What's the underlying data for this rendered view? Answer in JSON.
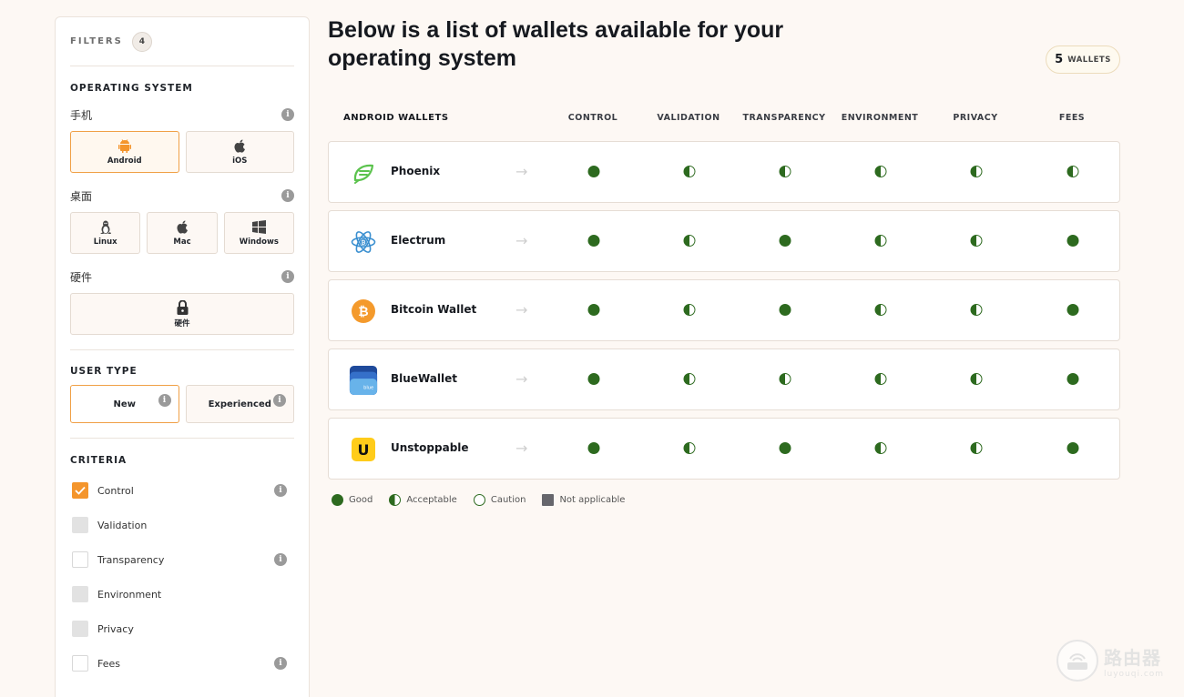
{
  "sidebar": {
    "filters_label": "FILTERS",
    "filters_count": "4",
    "os_section": "OPERATING SYSTEM",
    "mobile_label": "手机",
    "mobile_options": [
      "Android",
      "iOS"
    ],
    "desktop_label": "桌面",
    "desktop_options": [
      "Linux",
      "Mac",
      "Windows"
    ],
    "hardware_label": "硬件",
    "hardware_option": "硬件",
    "user_type_section": "USER TYPE",
    "user_types": [
      "New",
      "Experienced"
    ],
    "criteria_section": "CRITERIA",
    "criteria": [
      "Control",
      "Validation",
      "Transparency",
      "Environment",
      "Privacy",
      "Fees"
    ]
  },
  "main": {
    "title": "Below is a list of wallets available for your operating system",
    "wallet_count": "5",
    "wallet_count_label": "WALLETS",
    "table_heading": "ANDROID WALLETS",
    "columns": [
      "CONTROL",
      "VALIDATION",
      "TRANSPARENCY",
      "ENVIRONMENT",
      "PRIVACY",
      "FEES"
    ],
    "wallets": [
      {
        "name": "Phoenix",
        "ratings": [
          "good",
          "acceptable",
          "acceptable",
          "acceptable",
          "acceptable",
          "acceptable"
        ]
      },
      {
        "name": "Electrum",
        "ratings": [
          "good",
          "acceptable",
          "good",
          "acceptable",
          "acceptable",
          "good"
        ]
      },
      {
        "name": "Bitcoin Wallet",
        "ratings": [
          "good",
          "acceptable",
          "good",
          "acceptable",
          "acceptable",
          "good"
        ]
      },
      {
        "name": "BlueWallet",
        "ratings": [
          "good",
          "acceptable",
          "acceptable",
          "acceptable",
          "acceptable",
          "good"
        ]
      },
      {
        "name": "Unstoppable",
        "ratings": [
          "good",
          "acceptable",
          "good",
          "acceptable",
          "acceptable",
          "good"
        ]
      }
    ],
    "bluewallet_logo_text": "blue",
    "unstoppable_logo_text": "U",
    "arrow": "→"
  },
  "legend": [
    "Good",
    "Acceptable",
    "Caution",
    "Not applicable"
  ],
  "watermark": {
    "cn": "路由器",
    "en": "luyouqi.com"
  },
  "colors": {
    "accent": "#f4952c",
    "good": "#2d6a1f",
    "na": "#66666c"
  }
}
